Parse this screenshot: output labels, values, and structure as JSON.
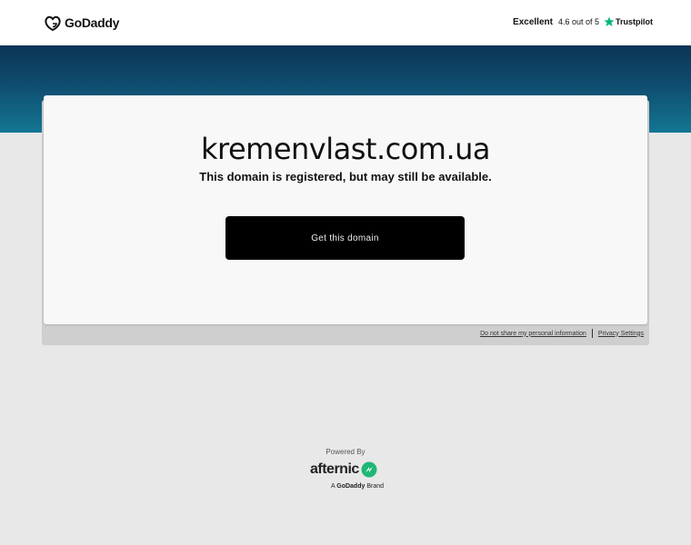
{
  "header": {
    "logo_text": "GoDaddy",
    "logo_icon": "godaddy-logo-icon",
    "rating_label": "Excellent",
    "rating_score": "4.6 out of 5",
    "trustpilot_label": "Trustpilot",
    "trustpilot_icon": "star-icon",
    "trustpilot_color": "#00b67a"
  },
  "colors": {
    "band_top": "#0b3556",
    "band_bottom": "#137693",
    "cta_background": "#000000",
    "page_background": "#e8e8e8"
  },
  "main": {
    "domain": "kremenvlast.com.ua",
    "subtitle": "This domain is registered, but may still be available.",
    "cta_label": "Get this domain"
  },
  "footer": {
    "links": [
      "Do not share my personal information",
      "Privacy Settings"
    ],
    "powered_by": "Powered By",
    "afternic_text": "afternic",
    "afternic_icon": "afternic-logo-icon",
    "brand_prefix": "A",
    "brand_name": "GoDaddy",
    "brand_suffix": "Brand"
  }
}
